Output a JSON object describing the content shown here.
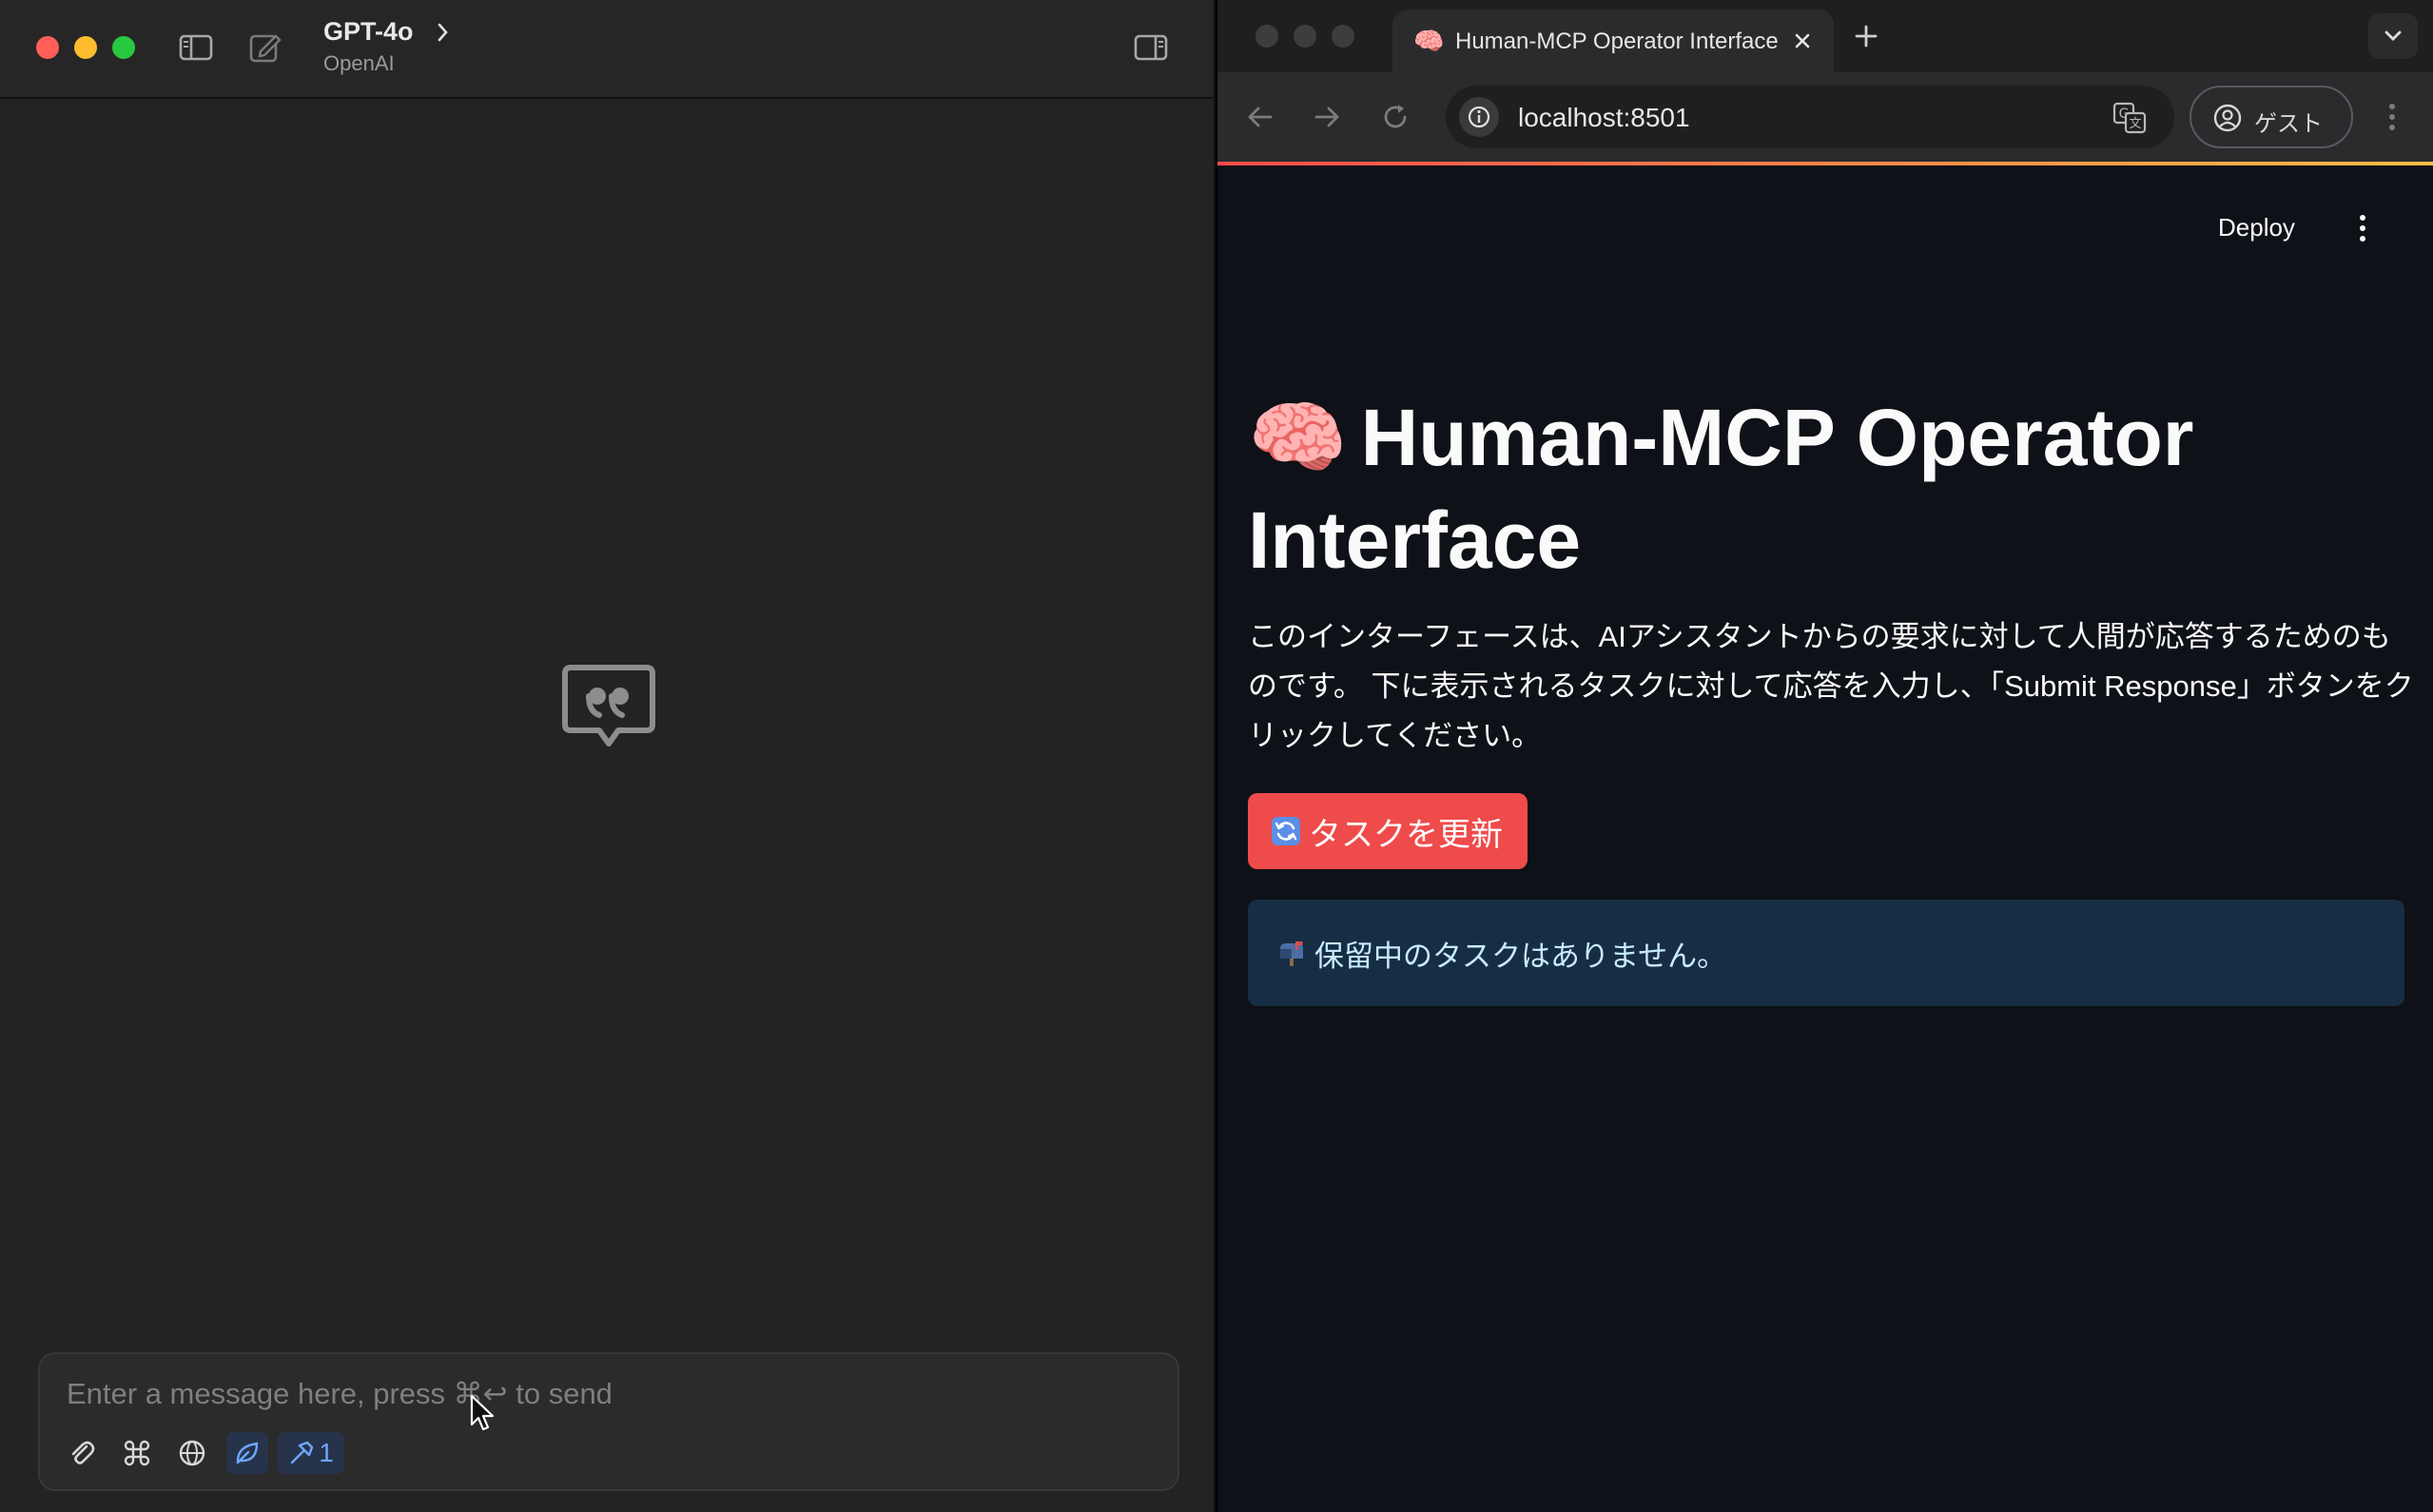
{
  "chat": {
    "model_name": "GPT-4o",
    "provider": "OpenAI",
    "composer": {
      "placeholder": "Enter a message here, press ⌘↩ to send",
      "tools_count": "1"
    }
  },
  "browser": {
    "tab": {
      "favicon": "🧠",
      "title": "Human-MCP Operator Interface"
    },
    "url": "localhost:8501",
    "profile_label": "ゲスト",
    "colors": {
      "accent": "#ff4b4b",
      "info_bg": "#172d43",
      "info_text": "#c7ebff"
    }
  },
  "page": {
    "deploy_label": "Deploy",
    "title_emoji": "🧠",
    "title": "Human-MCP Operator Interface",
    "description": "このインターフェースは、AIアシスタントからの要求に対して人間が応答するためのものです。 下に表示されるタスクに対して応答を入力し、「Submit Response」ボタンをクリックしてください。",
    "refresh_button_label": "タスクを更新",
    "info_message": "保留中のタスクはありません。"
  }
}
